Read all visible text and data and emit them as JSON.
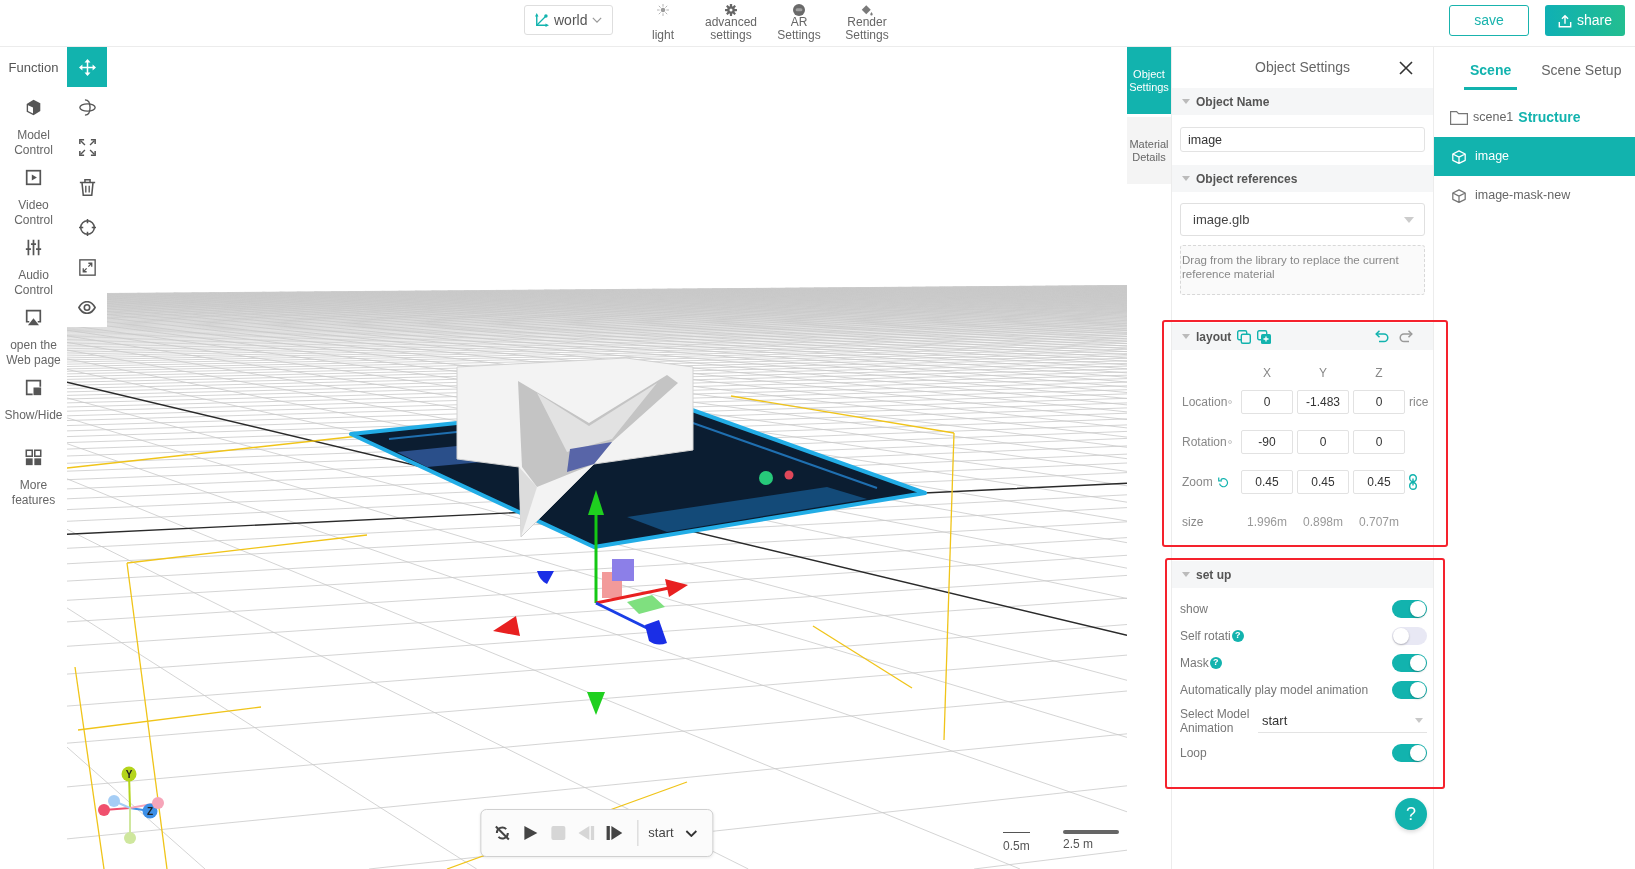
{
  "toolbar": {
    "coordinate_mode": {
      "label": "world"
    },
    "tools": [
      {
        "kind": "light",
        "label": "light"
      },
      {
        "kind": "advanced",
        "label": "advanced settings"
      },
      {
        "kind": "ar",
        "label": "AR Settings"
      },
      {
        "kind": "render",
        "label": "Render Settings"
      }
    ],
    "buttons": [
      {
        "kind": "save",
        "label": "save"
      },
      {
        "kind": "share",
        "label": "share"
      }
    ]
  },
  "function_panel": {
    "title": "Function",
    "items": [
      {
        "kind": "model",
        "label": "Model Control"
      },
      {
        "kind": "video",
        "label": "Video Control"
      },
      {
        "kind": "audio",
        "label": "Audio Control"
      },
      {
        "kind": "web",
        "label": "open the Web page"
      },
      {
        "kind": "show-hide",
        "label": "Show/Hide"
      },
      {
        "kind": "more",
        "label": "More features"
      }
    ]
  },
  "transform_tools": [
    {
      "kind": "move",
      "selected": true
    },
    {
      "kind": "rotate",
      "selected": false
    },
    {
      "kind": "scale",
      "selected": false
    },
    {
      "kind": "delete",
      "selected": false
    },
    {
      "kind": "focus",
      "selected": false
    },
    {
      "kind": "shrink",
      "selected": false
    },
    {
      "kind": "visibility",
      "selected": false
    }
  ],
  "viewport": {
    "axis_gizmo": [
      {
        "label": "Y",
        "color": "#b4d41c"
      },
      {
        "label": "Z",
        "color": "#3d8fe6"
      },
      {
        "color": "#f0506e"
      },
      {
        "color": "#a5cdf5"
      },
      {
        "color": "#f6a5b9"
      },
      {
        "color": "#cfe79e"
      }
    ],
    "player": {
      "controls": [
        {
          "kind": "no-loop",
          "disabled": false
        },
        {
          "kind": "play",
          "disabled": false
        },
        {
          "kind": "stop",
          "disabled": true
        },
        {
          "kind": "step-back",
          "disabled": true
        },
        {
          "kind": "step-forward",
          "disabled": false
        }
      ],
      "animation": "start"
    },
    "scale_bar": [
      {
        "kind": "thin",
        "label": "0.5m"
      },
      {
        "kind": "thick",
        "label": "2.5 m"
      }
    ]
  },
  "side_tabs": [
    {
      "label": "Object Settings",
      "selected": true
    },
    {
      "label": "Material Details",
      "selected": false
    }
  ],
  "object_settings": {
    "title": "Object Settings",
    "object_name": {
      "heading": "Object Name",
      "expanded": true,
      "value": "image"
    },
    "object_references": {
      "heading": "Object references",
      "expanded": true,
      "value": "image.glb",
      "drop_hint": "Drag from the library to replace the current reference material"
    },
    "layout": {
      "heading": "layout",
      "expanded": true,
      "highlighted": true,
      "actions": [
        {
          "kind": "copy",
          "disabled": false
        },
        {
          "kind": "paste",
          "disabled": false
        },
        {
          "kind": "undo",
          "disabled": false
        },
        {
          "kind": "redo",
          "disabled": true
        }
      ],
      "axes": [
        "X",
        "Y",
        "Z"
      ],
      "rows": [
        {
          "kind": "dot",
          "label": "Location",
          "values": [
            "0",
            "-1.483",
            "0"
          ],
          "suffix": "rice"
        },
        {
          "kind": "dot",
          "label": "Rotation",
          "values": [
            "-90",
            "0",
            "0"
          ]
        },
        {
          "kind": "scale",
          "label": "Zoom",
          "values": [
            "0.45",
            "0.45",
            "0.45"
          ]
        }
      ],
      "size": {
        "label": "size",
        "values": [
          "1.996m",
          "0.898m",
          "0.707m"
        ]
      }
    },
    "setup": {
      "heading": "set up",
      "expanded": true,
      "highlighted": true,
      "rows": [
        {
          "kind": "toggle",
          "label": "show",
          "on": true
        },
        {
          "kind": "toggle",
          "label": "Self rotati",
          "help": "?",
          "on": false
        },
        {
          "kind": "toggle",
          "label": "Mask",
          "help": "?",
          "on": true
        },
        {
          "kind": "toggle",
          "label": "Automatically play model animation",
          "on": true
        },
        {
          "kind": "select",
          "label": "Select Model Animation",
          "value": "start"
        },
        {
          "kind": "toggle",
          "label": "Loop",
          "on": true
        }
      ]
    },
    "help_button": "?"
  },
  "scene_panel": {
    "tabs": [
      {
        "label": "Scene",
        "selected": true
      },
      {
        "label": "Scene Setup",
        "selected": false
      }
    ],
    "tree": [
      {
        "kind": "folder",
        "label": "scene1",
        "heading": "Structure",
        "selected": false
      },
      {
        "kind": "model",
        "label": "image",
        "selected": true
      },
      {
        "kind": "model",
        "label": "image-mask-new",
        "selected": false
      }
    ]
  }
}
